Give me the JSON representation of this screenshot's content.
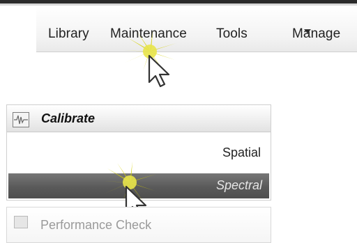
{
  "menubar": {
    "items": [
      {
        "label": "Library"
      },
      {
        "label": "Maintenance"
      },
      {
        "label": "Tools"
      },
      {
        "label": "Manage"
      }
    ],
    "dropdown_icon": "caret-down-icon"
  },
  "calibrate_panel": {
    "title": "Calibrate",
    "icon": "waveform-icon",
    "items": [
      {
        "label": "Spatial",
        "selected": false
      },
      {
        "label": "Spectral",
        "selected": true
      }
    ]
  },
  "next_section": {
    "label": "Performance Check",
    "icon": "checkbox-icon"
  },
  "highlights": {
    "burst_color": "#d4d000",
    "cursor_icon": "arrow-cursor-icon"
  }
}
